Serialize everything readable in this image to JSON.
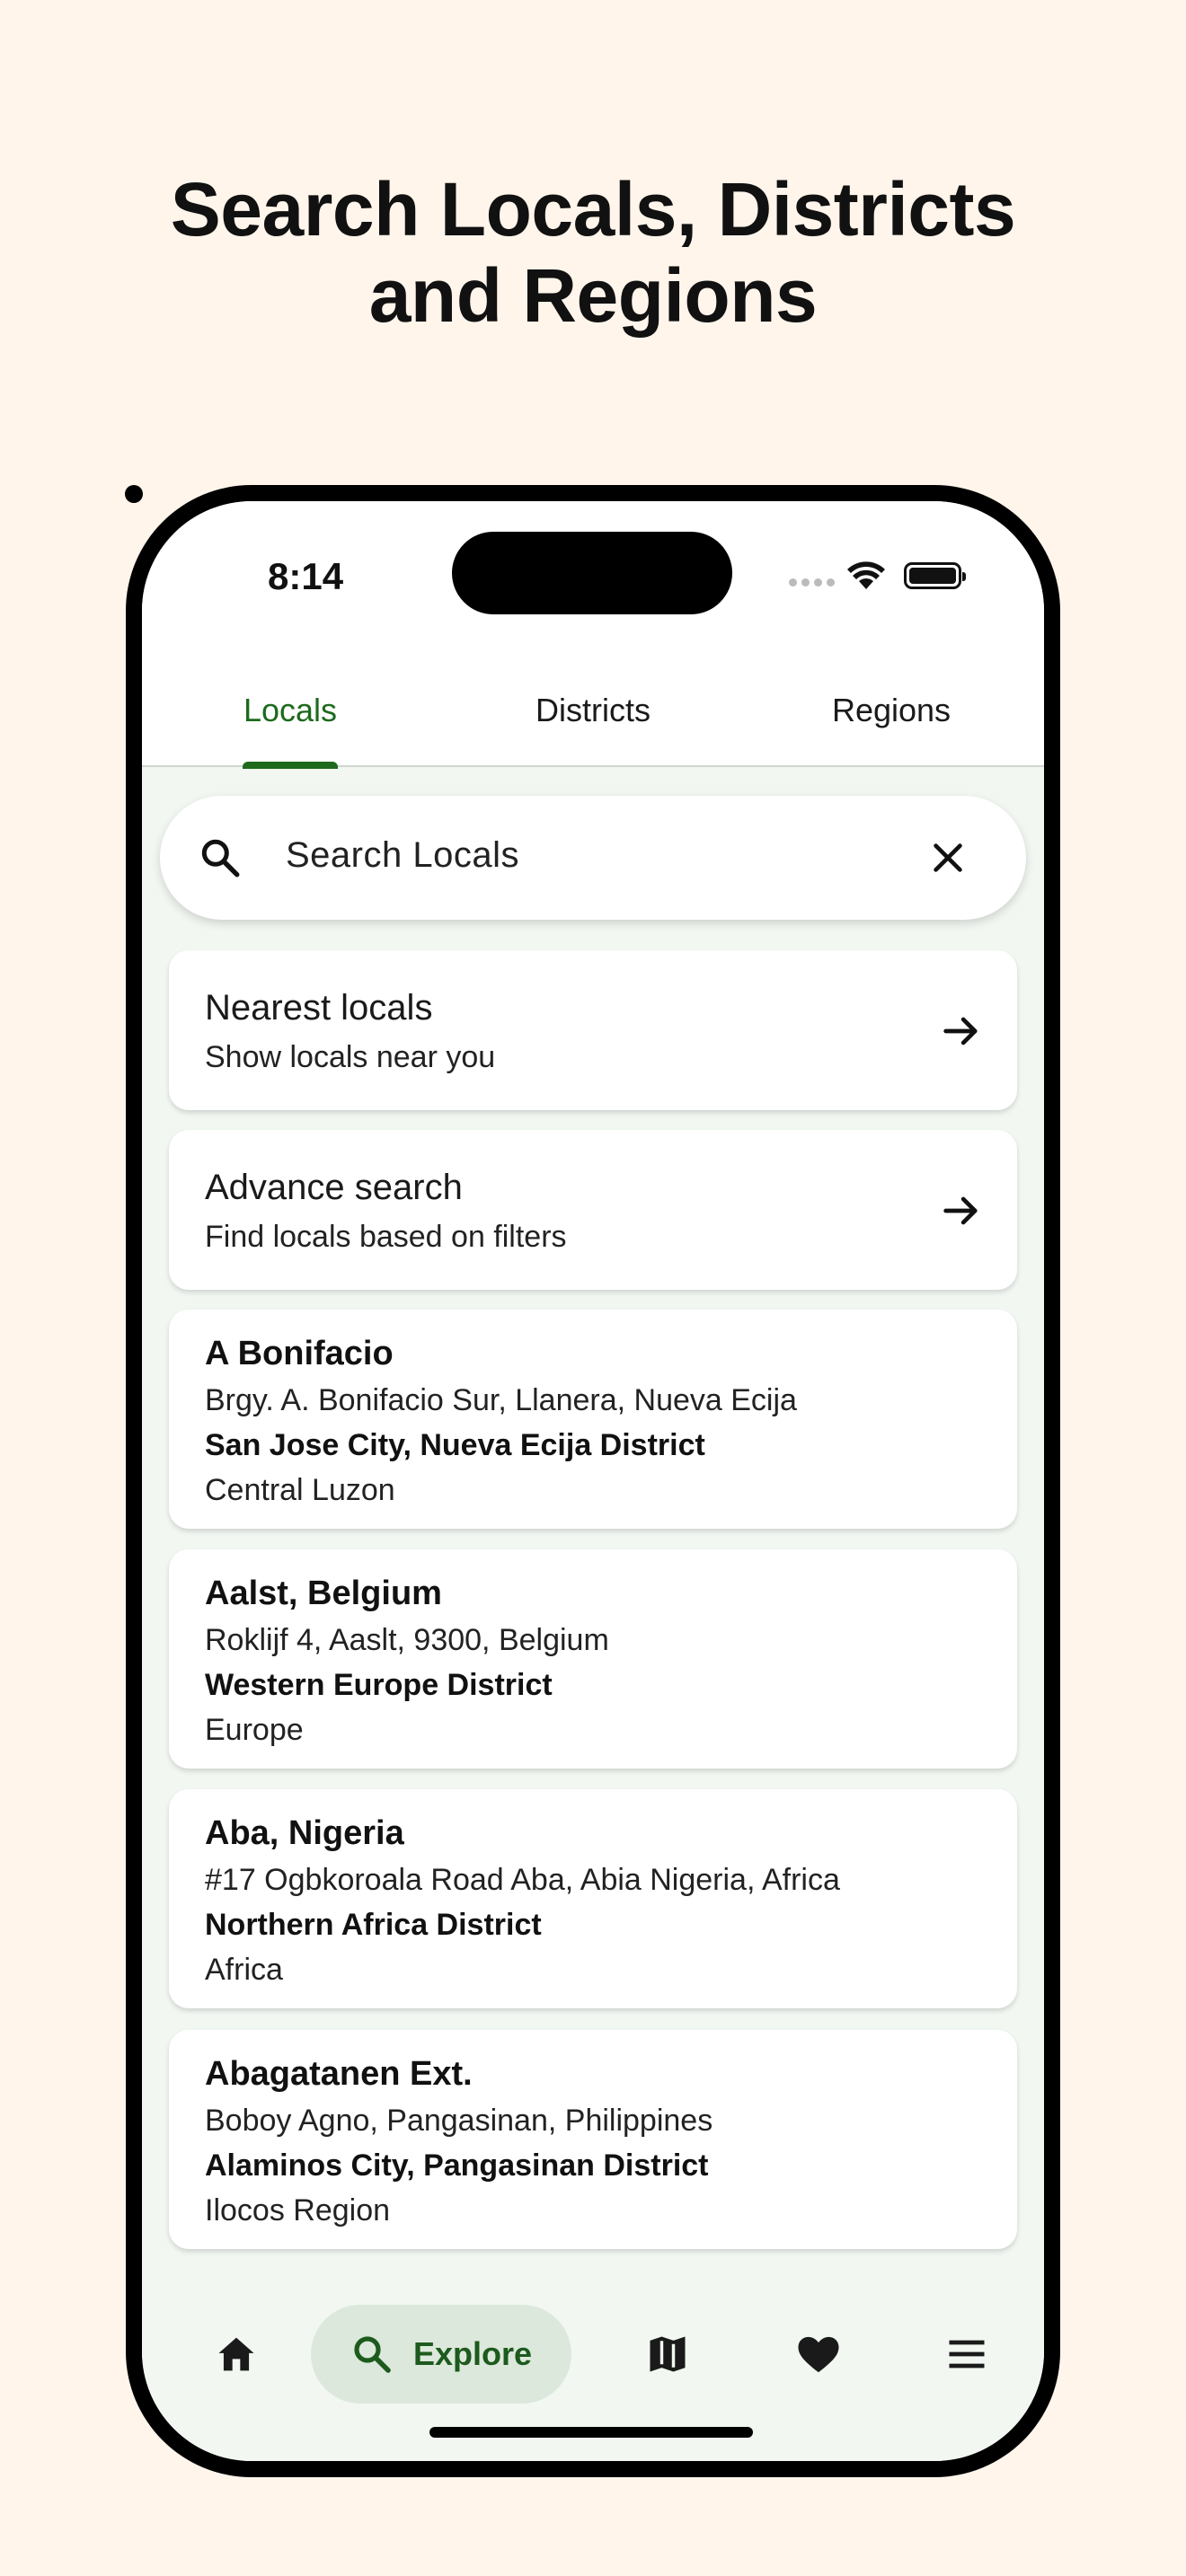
{
  "headline": {
    "line1": "Search Locals, Districts",
    "line2": "and Regions"
  },
  "status_bar": {
    "time": "8:14"
  },
  "tabs": [
    {
      "label": "Locals",
      "active": true
    },
    {
      "label": "Districts",
      "active": false
    },
    {
      "label": "Regions",
      "active": false
    }
  ],
  "search": {
    "placeholder": "Search Locals"
  },
  "actions": [
    {
      "title": "Nearest locals",
      "subtitle": "Show locals near you"
    },
    {
      "title": "Advance search",
      "subtitle": "Find locals based on filters"
    }
  ],
  "locals": [
    {
      "name": "A Bonifacio",
      "address": "Brgy. A. Bonifacio Sur, Llanera, Nueva Ecija",
      "district": "San Jose City, Nueva Ecija District",
      "region": "Central Luzon"
    },
    {
      "name": "Aalst, Belgium",
      "address": "Roklijf 4, Aaslt, 9300, Belgium",
      "district": "Western Europe District",
      "region": "Europe"
    },
    {
      "name": "Aba, Nigeria",
      "address": "#17 Ogbkoroala Road Aba, Abia Nigeria, Africa",
      "district": "Northern Africa  District",
      "region": "Africa"
    },
    {
      "name": "Abagatanen Ext.",
      "address": "Boboy  Agno, Pangasinan, Philippines",
      "district": "Alaminos City, Pangasinan District",
      "region": "Ilocos Region"
    }
  ],
  "bottom_nav": {
    "active_label": "Explore",
    "items": [
      "home-icon",
      "search-icon",
      "map-icon",
      "heart-icon",
      "menu-icon"
    ]
  },
  "colors": {
    "accent": "#1d6a1d",
    "background": "#fff5eb",
    "pill": "#dde8dc"
  }
}
